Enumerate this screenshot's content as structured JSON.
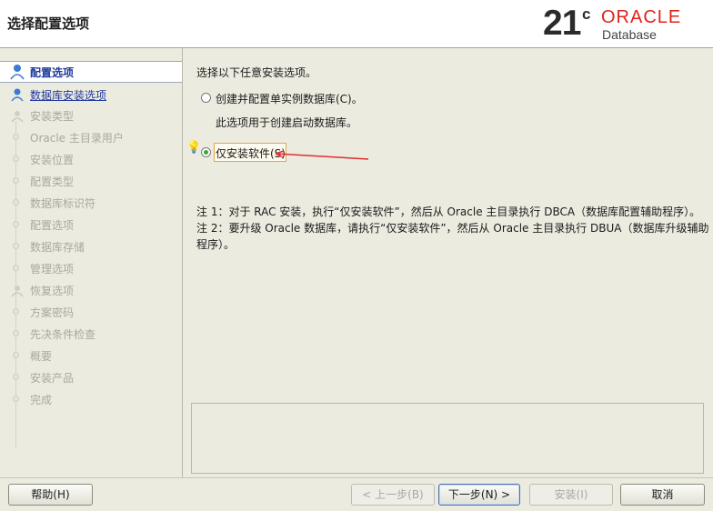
{
  "header": {
    "title": "选择配置选项",
    "logo": {
      "version": "21",
      "sup": "c",
      "brand": "ORACLE",
      "product": "Database",
      "brand_color": "#e2231a"
    }
  },
  "sidebar": {
    "steps": [
      {
        "label": "配置选项",
        "state": "active"
      },
      {
        "label": "数据库安装选项",
        "state": "link"
      },
      {
        "label": "安装类型",
        "state": "disabled"
      },
      {
        "label": "Oracle 主目录用户",
        "state": "disabled"
      },
      {
        "label": "安装位置",
        "state": "disabled"
      },
      {
        "label": "配置类型",
        "state": "disabled"
      },
      {
        "label": "数据库标识符",
        "state": "disabled"
      },
      {
        "label": "配置选项",
        "state": "disabled"
      },
      {
        "label": "数据库存储",
        "state": "disabled"
      },
      {
        "label": "管理选项",
        "state": "disabled"
      },
      {
        "label": "恢复选项",
        "state": "disabled"
      },
      {
        "label": "方案密码",
        "state": "disabled"
      },
      {
        "label": "先决条件检查",
        "state": "disabled"
      },
      {
        "label": "概要",
        "state": "disabled"
      },
      {
        "label": "安装产品",
        "state": "disabled"
      },
      {
        "label": "完成",
        "state": "disabled"
      }
    ]
  },
  "main": {
    "prompt": "选择以下任意安装选项。",
    "option1": {
      "label": "创建并配置单实例数据库(C)。",
      "desc": "此选项用于创建启动数据库。",
      "checked": false
    },
    "option2": {
      "label": "仅安装软件(S)",
      "checked": true
    },
    "note1": "注 1：对于 RAC 安装，执行“仅安装软件”，然后从 Oracle 主目录执行 DBCA（数据库配置辅助程序）。",
    "note2a": "注 2：要升级 Oracle 数据库，请执行“仅安装软件”，然后从 Oracle 主目录执行 DBUA（数据库升级辅助",
    "note2b": "程序）。"
  },
  "footer": {
    "help": "帮助(H)",
    "back": "< 上一步(B)",
    "next": "下一步(N) >",
    "install": "安装(I)",
    "cancel": "取消"
  }
}
